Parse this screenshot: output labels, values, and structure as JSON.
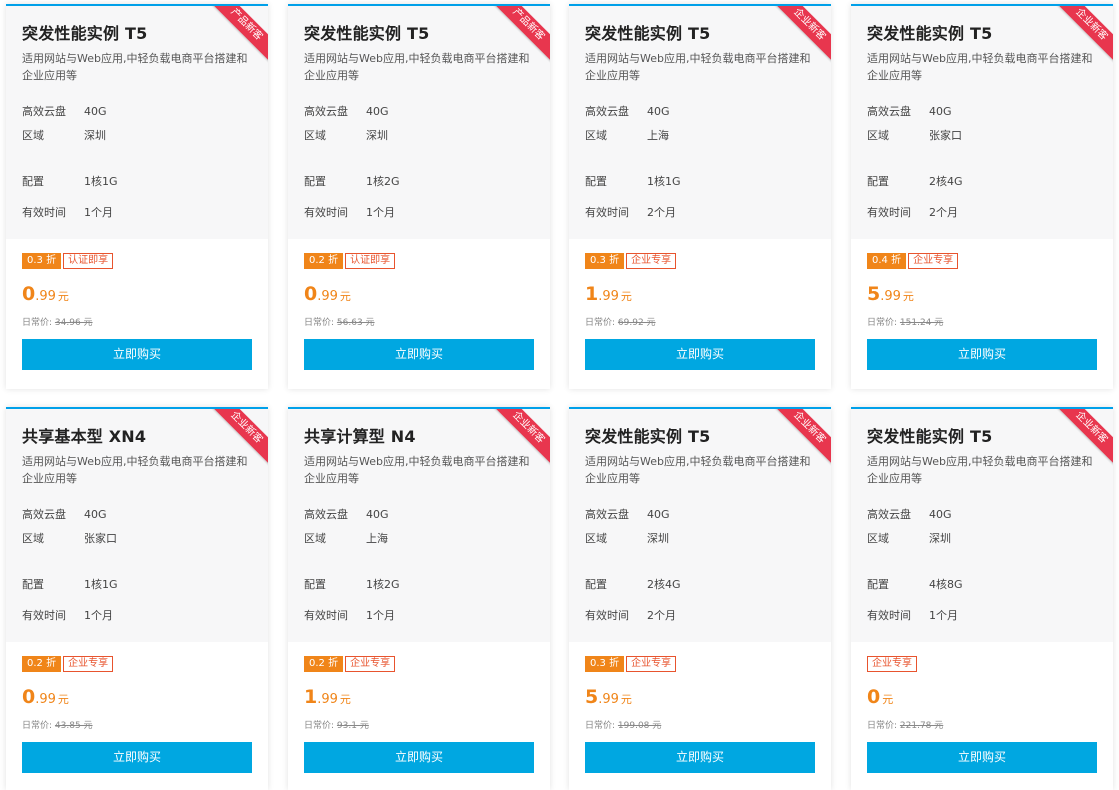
{
  "labels": {
    "disk": "高效云盘",
    "region": "区域",
    "config": "配置",
    "duration": "有效时间",
    "orig_prefix": "日常价:",
    "buy": "立即购买",
    "desc": "适用网站与Web应用,中轻负载电商平台搭建和企业应用等"
  },
  "cards": [
    {
      "title": "突发性能实例 T5",
      "ribbon": "产品新客",
      "disk": "40G",
      "region": "深圳",
      "config": "1核1G",
      "duration": "1个月",
      "discount": "0.3 折",
      "tag": "认证即享",
      "price_int": "0",
      "price_dec": ".99",
      "unit": "元",
      "orig": "34.96 元"
    },
    {
      "title": "突发性能实例 T5",
      "ribbon": "产品新客",
      "disk": "40G",
      "region": "深圳",
      "config": "1核2G",
      "duration": "1个月",
      "discount": "0.2 折",
      "tag": "认证即享",
      "price_int": "0",
      "price_dec": ".99",
      "unit": "元",
      "orig": "56.63 元"
    },
    {
      "title": "突发性能实例 T5",
      "ribbon": "企业新客",
      "disk": "40G",
      "region": "上海",
      "config": "1核1G",
      "duration": "2个月",
      "discount": "0.3 折",
      "tag": "企业专享",
      "price_int": "1",
      "price_dec": ".99",
      "unit": "元",
      "orig": "69.92 元"
    },
    {
      "title": "突发性能实例 T5",
      "ribbon": "企业新客",
      "disk": "40G",
      "region": "张家口",
      "config": "2核4G",
      "duration": "2个月",
      "discount": "0.4 折",
      "tag": "企业专享",
      "price_int": "5",
      "price_dec": ".99",
      "unit": "元",
      "orig": "151.24 元"
    },
    {
      "title": "共享基本型 XN4",
      "ribbon": "企业新客",
      "disk": "40G",
      "region": "张家口",
      "config": "1核1G",
      "duration": "1个月",
      "discount": "0.2 折",
      "tag": "企业专享",
      "price_int": "0",
      "price_dec": ".99",
      "unit": "元",
      "orig": "43.85 元"
    },
    {
      "title": "共享计算型 N4",
      "ribbon": "企业新客",
      "disk": "40G",
      "region": "上海",
      "config": "1核2G",
      "duration": "1个月",
      "discount": "0.2 折",
      "tag": "企业专享",
      "price_int": "1",
      "price_dec": ".99",
      "unit": "元",
      "orig": "93.1 元"
    },
    {
      "title": "突发性能实例 T5",
      "ribbon": "企业新客",
      "disk": "40G",
      "region": "深圳",
      "config": "2核4G",
      "duration": "2个月",
      "discount": "0.3 折",
      "tag": "企业专享",
      "price_int": "5",
      "price_dec": ".99",
      "unit": "元",
      "orig": "199.08 元"
    },
    {
      "title": "突发性能实例 T5",
      "ribbon": "企业新客",
      "disk": "40G",
      "region": "深圳",
      "config": "4核8G",
      "duration": "1个月",
      "discount": "",
      "tag": "企业专享",
      "price_int": "0",
      "price_dec": "",
      "unit": "元",
      "orig": "221.78 元"
    }
  ]
}
